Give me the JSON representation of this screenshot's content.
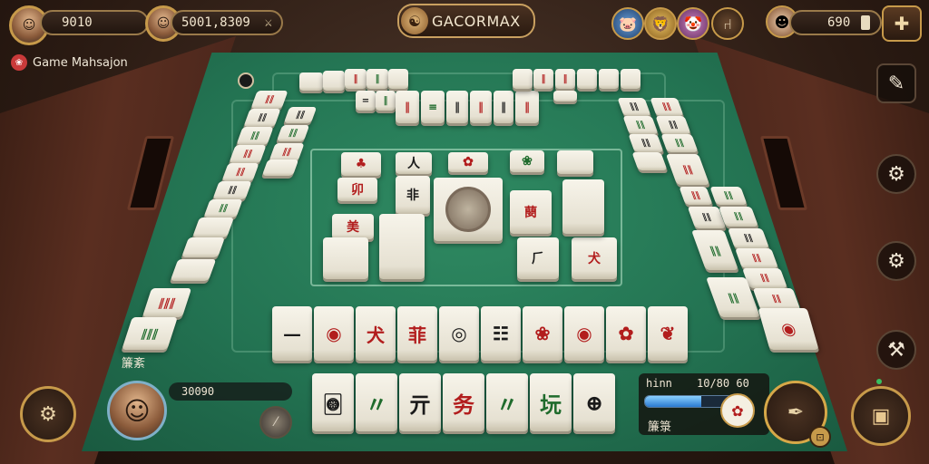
{
  "top_bar": {
    "left_score": "9010",
    "center_score": "5001,8309",
    "center_icon": "crossed-swords-icon",
    "title": "GACORMAX",
    "right_value": "690",
    "right_icons": [
      "pig-mascot-icon",
      "lion-mascot-icon",
      "clown-mascot-icon",
      "chair-icon",
      "boxer-mascot-icon"
    ]
  },
  "game_label": "Game Mahsajon",
  "player": {
    "name_glyphs": "簾紊",
    "score": "30090"
  },
  "right_panel": {
    "label": "hinn",
    "value": "10/80 60",
    "progress": 0.65,
    "glyphs": "簾箓"
  },
  "side_menu": [
    "edit-icon",
    "settings-gear-icon",
    "settings-gear-icon",
    "hand-tools-icon"
  ],
  "table": {
    "felt_color": "#237352",
    "center_tile": "coin-medallion"
  },
  "hand_tiles": [
    {
      "glyph": "🀙",
      "tone": "black"
    },
    {
      "glyph": "〃",
      "tone": "green"
    },
    {
      "glyph": "亓",
      "tone": "black"
    },
    {
      "glyph": "务",
      "tone": "red"
    },
    {
      "glyph": "〃",
      "tone": "green"
    },
    {
      "glyph": "坃",
      "tone": "green"
    },
    {
      "glyph": "⊕",
      "tone": "black"
    }
  ],
  "front_row": [
    {
      "glyph": "—",
      "tone": "black"
    },
    {
      "glyph": "◉",
      "tone": "red"
    },
    {
      "glyph": "犬",
      "tone": "red"
    },
    {
      "glyph": "菲",
      "tone": "red"
    },
    {
      "glyph": "◎",
      "tone": "black"
    },
    {
      "glyph": "☷",
      "tone": "black"
    },
    {
      "glyph": "❀",
      "tone": "red"
    },
    {
      "glyph": "◉",
      "tone": "red"
    },
    {
      "glyph": "✿",
      "tone": "red"
    },
    {
      "glyph": "❦",
      "tone": "red"
    }
  ],
  "center_tiles": [
    {
      "glyph": "♣",
      "tone": "red"
    },
    {
      "glyph": "人",
      "tone": "black"
    },
    {
      "glyph": "卯",
      "tone": "red"
    },
    {
      "glyph": "非",
      "tone": "black"
    },
    {
      "glyph": "美",
      "tone": "red"
    },
    {
      "glyph": "✿",
      "tone": "red"
    },
    {
      "glyph": "❀",
      "tone": "green"
    },
    {
      "glyph": "蔅",
      "tone": "red"
    },
    {
      "glyph": "犬",
      "tone": "red"
    },
    {
      "glyph": "⺁",
      "tone": "black"
    }
  ]
}
